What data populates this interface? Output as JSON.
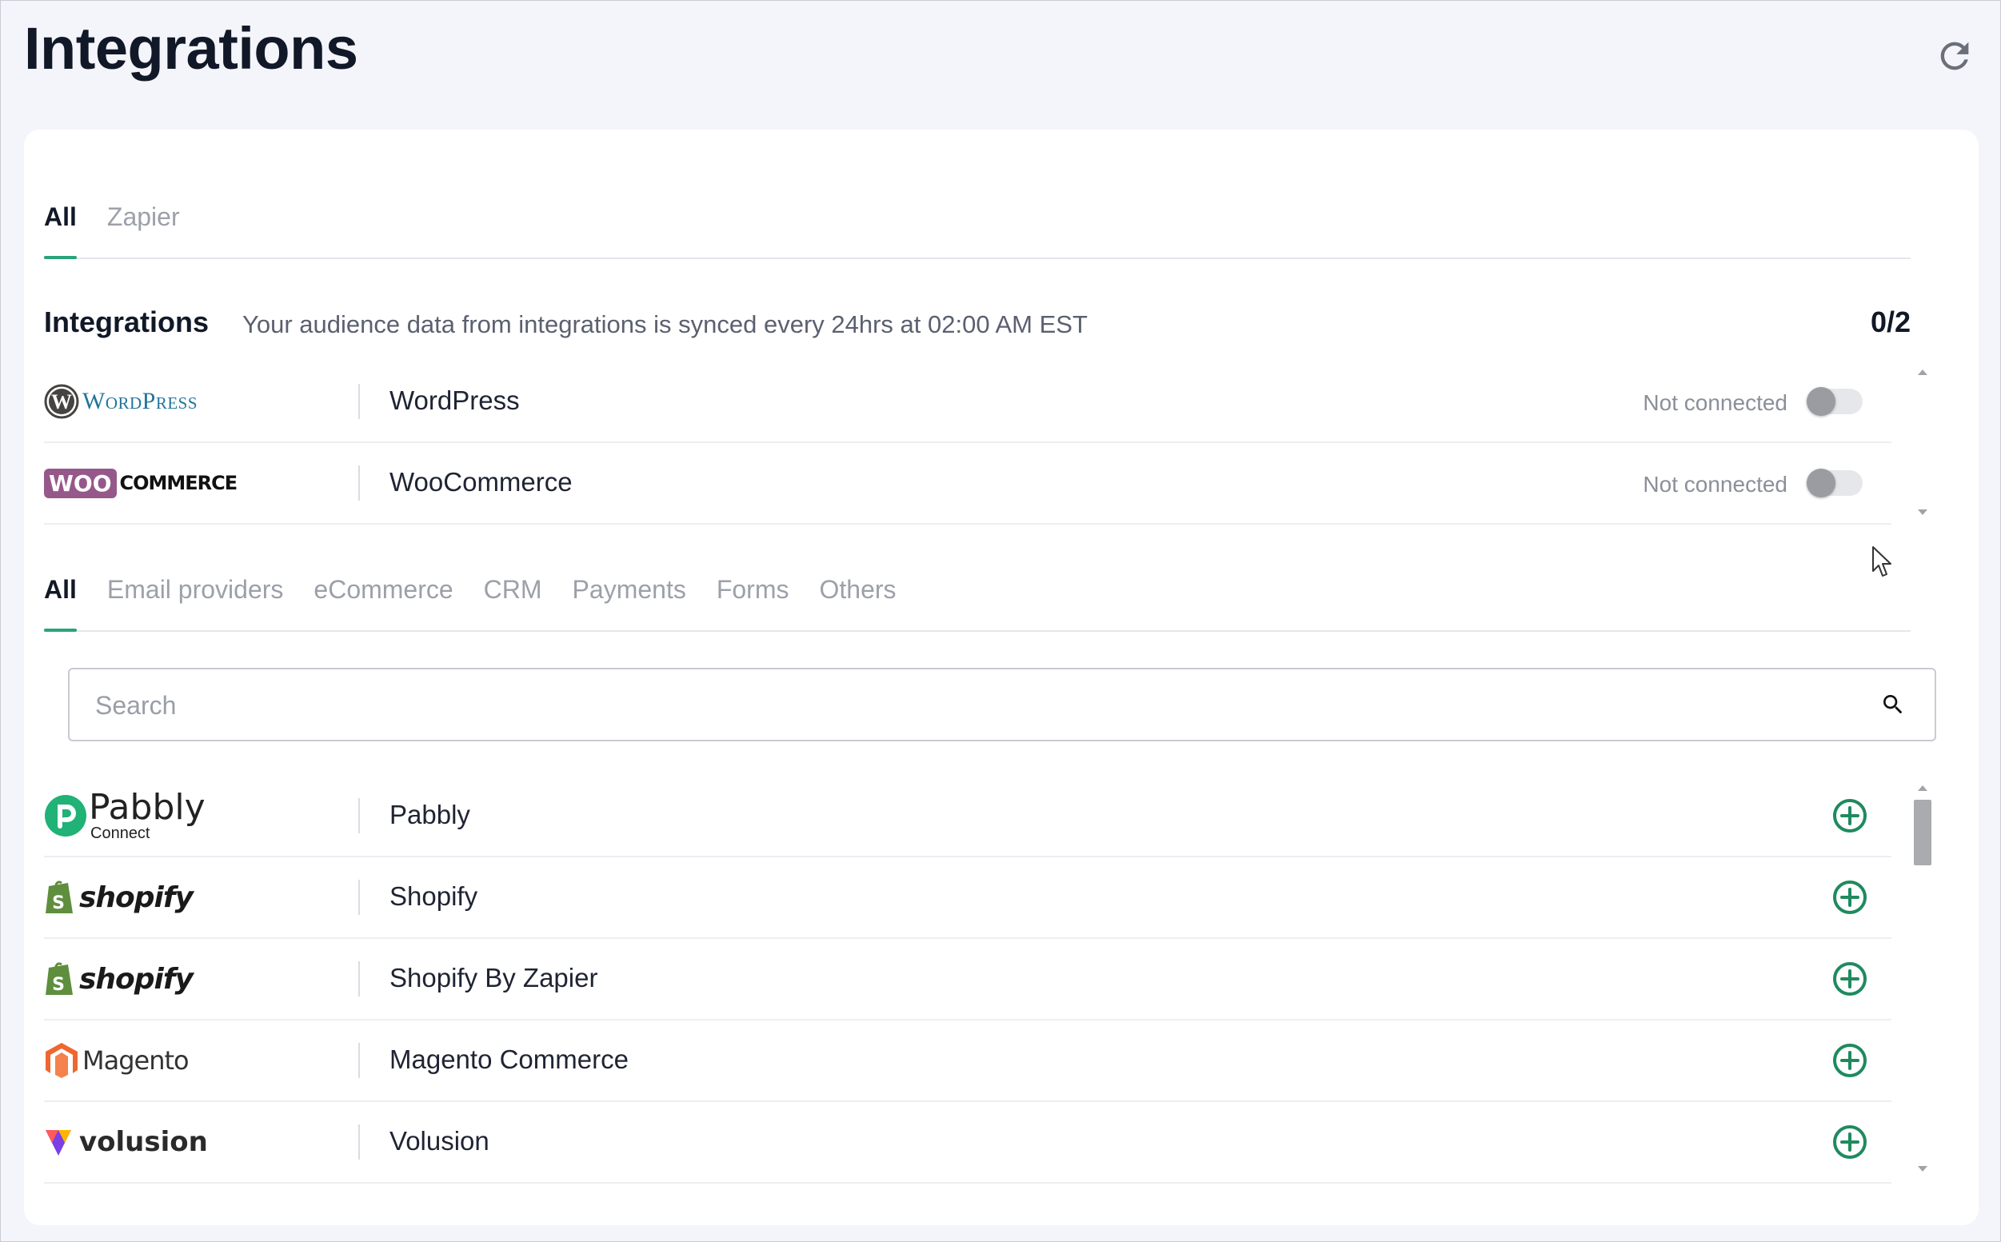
{
  "page": {
    "title": "Integrations"
  },
  "top_tabs": [
    {
      "label": "All",
      "active": true
    },
    {
      "label": "Zapier",
      "active": false
    }
  ],
  "integrations_section": {
    "title": "Integrations",
    "description": "Your audience data from integrations is synced every 24hrs at 02:00 AM EST",
    "count": "0/2",
    "items": [
      {
        "name": "WordPress",
        "logo_word": "WordPress",
        "status": "Not connected",
        "connected": false,
        "icon": "wordpress-logo"
      },
      {
        "name": "WooCommerce",
        "logo_word1": "WOO",
        "logo_word2": "COMMERCE",
        "status": "Not connected",
        "connected": false,
        "icon": "woocommerce-logo"
      }
    ]
  },
  "category_tabs": [
    {
      "label": "All",
      "active": true
    },
    {
      "label": "Email providers",
      "active": false
    },
    {
      "label": "eCommerce",
      "active": false
    },
    {
      "label": "CRM",
      "active": false
    },
    {
      "label": "Payments",
      "active": false
    },
    {
      "label": "Forms",
      "active": false
    },
    {
      "label": "Others",
      "active": false
    }
  ],
  "search": {
    "placeholder": "Search",
    "value": ""
  },
  "available": [
    {
      "name": "Pabbly",
      "logo_word": "Pabbly",
      "logo_sub": "Connect",
      "icon": "pabbly-logo"
    },
    {
      "name": "Shopify",
      "logo_word": "shopify",
      "icon": "shopify-logo"
    },
    {
      "name": "Shopify By Zapier",
      "logo_word": "shopify",
      "icon": "shopify-logo"
    },
    {
      "name": "Magento Commerce",
      "logo_word": "Magento",
      "icon": "magento-logo"
    },
    {
      "name": "Volusion",
      "logo_word": "volusion",
      "icon": "volusion-logo"
    }
  ],
  "colors": {
    "accent": "#2aa37a",
    "add_icon": "#1f8a5e",
    "woo_purple": "#96588a",
    "wp_teal": "#21759b",
    "shopify_green": "#5e8e3e",
    "magento_orange": "#ee672f"
  }
}
